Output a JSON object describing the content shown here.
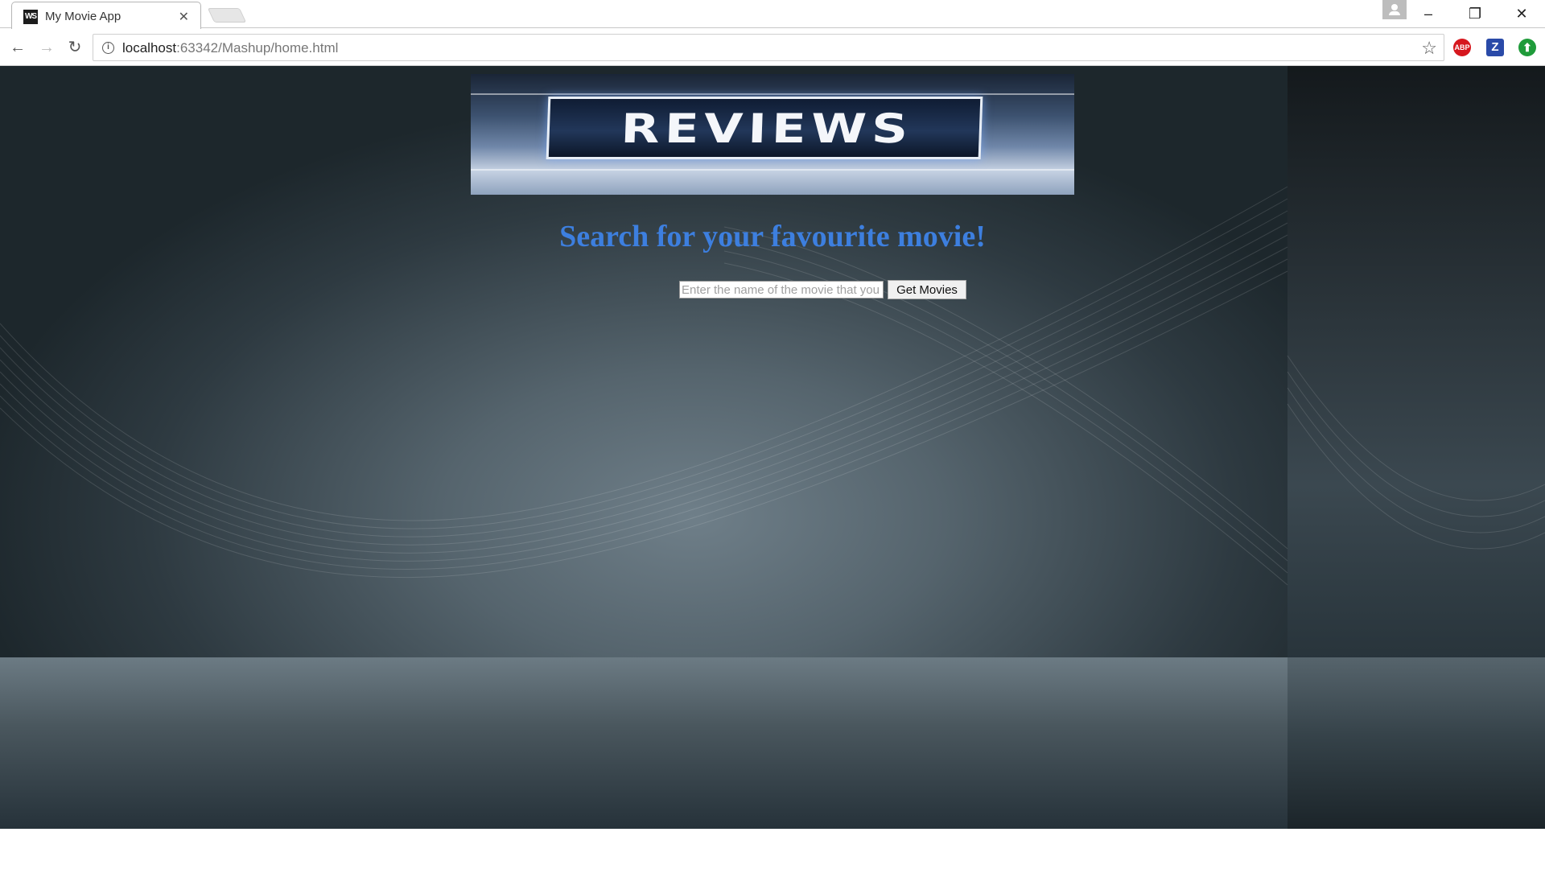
{
  "browser": {
    "tab": {
      "title": "My Movie App",
      "favicon_text": "WS",
      "close_glyph": "✕"
    },
    "address": {
      "host": "localhost",
      "rest": ":63342/Mashup/home.html"
    },
    "extensions": {
      "abp_label": "ABP",
      "z_label": "Z",
      "up_glyph": "⬆"
    }
  },
  "page": {
    "banner_text": "REVIEWS",
    "heading": "Search for your favourite movie!",
    "search": {
      "placeholder": "Enter the name of the movie that you want to search",
      "value": ""
    },
    "button_label": "Get Movies"
  },
  "colors": {
    "heading": "#3d7fdf",
    "page_background": "#3f4d55"
  },
  "icons": [
    "info-icon",
    "star-icon",
    "back-arrow-icon",
    "forward-arrow-icon",
    "reload-icon",
    "close-icon",
    "minimize-icon",
    "maximize-icon",
    "profile-icon"
  ]
}
